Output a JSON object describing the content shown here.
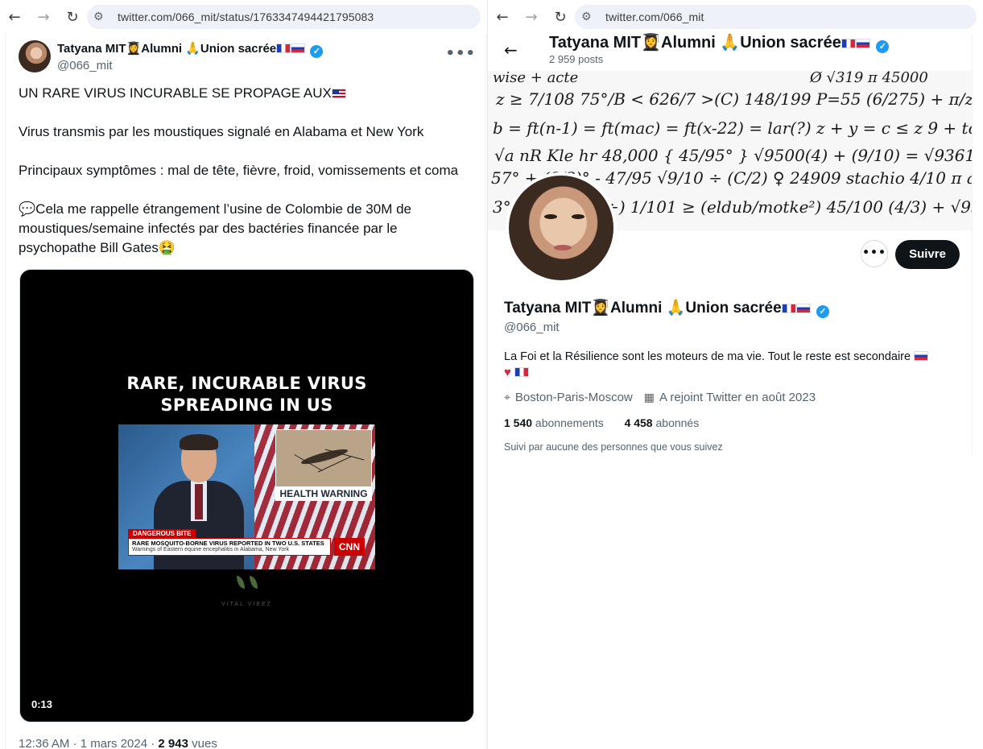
{
  "left": {
    "browser": {
      "back_icon": "←",
      "forward_icon": "→",
      "reload_icon": "↻",
      "tune_icon": "⚙",
      "url": "twitter.com/066_mit/status/1763347494421795083"
    },
    "tweet": {
      "author_name": "Tatyana MIT👩‍🎓Alumni 🙏Union sacrée",
      "author_handle": "@066_mit",
      "more_icon": "•••",
      "text_line1": "UN RARE VIRUS INCURABLE SE PROPAGE AUX",
      "text_line2": "Virus transmis par les moustiques signalé en Alabama et New York",
      "text_line3": "Principaux symptômes : mal de tête, fièvre, froid, vomissements et coma",
      "text_line4": "💬Cela me rappelle étrangement l’usine de Colombie de 30M de moustiques/semaine infectés par des bactéries financée par le psychopathe Bill Gates🤮",
      "video": {
        "title_line1": "RARE, INCURABLE VIRUS",
        "title_line2": "SPREADING IN US",
        "health_warning": "HEALTH WARNING",
        "tag": "DANGEROUS BITE",
        "headline": "RARE MOSQUITO-BORNE VIRUS REPORTED IN TWO U.S. STATES",
        "subline": "Warnings of Eastern equine encephalitis in Alabama, New York",
        "network": "CNN",
        "brand": "VITAL VIBEZ",
        "duration": "0:13"
      },
      "time": "12:36 AM · 1 mars 2024 · ",
      "views_count": "2 943",
      "views_label": " vues"
    }
  },
  "right": {
    "browser": {
      "back_icon": "←",
      "forward_icon": "→",
      "reload_icon": "↻",
      "tune_icon": "⚙",
      "url": "twitter.com/066_mit"
    },
    "profile": {
      "back_icon": "←",
      "top_name": "Tatyana MIT👩‍🎓Alumni 🙏Union sacrée",
      "posts": "2 959 posts",
      "more_icon": "•••",
      "follow_label": "Suivre",
      "name": "Tatyana MIT👩‍🎓Alumni 🙏Union sacrée",
      "handle": "@066_mit",
      "bio": "La Foi et la Résilience sont les moteurs de ma vie. Tout le reste est secondaire",
      "heart": "♥",
      "location_icon": "⌖",
      "location": "Boston-Paris-Moscow",
      "joined_icon": "▦",
      "joined": "A rejoint Twitter en août 2023",
      "following_count": "1 540",
      "following_label": " abonnements",
      "followers_count": "4 458",
      "followers_label": " abonnés",
      "followed_by": "Suivi par aucune des personnes que vous suivez"
    }
  },
  "colors": {
    "verified": "#1d9bf0",
    "follow_button": "#0f1419",
    "secondary_text": "#536471"
  }
}
